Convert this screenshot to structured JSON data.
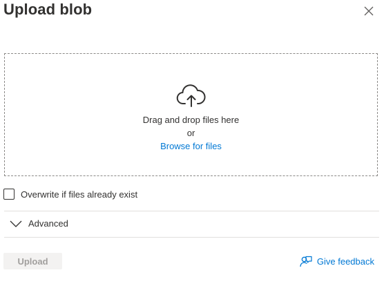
{
  "panel": {
    "title": "Upload blob",
    "close_icon": "close-icon"
  },
  "dropzone": {
    "icon": "cloud-upload-icon",
    "instruction": "Drag and drop files here",
    "or_text": "or",
    "browse_link": "Browse for files"
  },
  "options": {
    "overwrite_label": "Overwrite if files already exist",
    "overwrite_checked": false
  },
  "advanced": {
    "label": "Advanced",
    "icon": "chevron-down-icon",
    "expanded": false
  },
  "footer": {
    "upload_label": "Upload",
    "upload_enabled": false,
    "feedback_label": "Give feedback",
    "feedback_icon": "feedback-person-icon"
  },
  "colors": {
    "accent": "#0078d4",
    "text": "#323130",
    "disabled_bg": "#f3f2f1",
    "disabled_text": "#a19f9d",
    "divider": "#e1dfdd"
  }
}
